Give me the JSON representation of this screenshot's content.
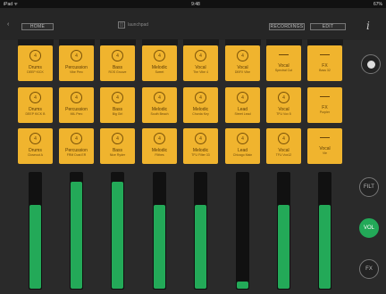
{
  "status": {
    "left": "iPad ᯤ",
    "time": "9:48",
    "battery": "67%"
  },
  "toolbar": {
    "home_label": "HOME",
    "recordings_label": "RECORDINGS",
    "edit_label": "EDIT",
    "logo_text": "launchpad"
  },
  "pads": [
    [
      {
        "name": "Drums",
        "sub": "DEEP KICK",
        "icon": "4"
      },
      {
        "name": "Percussion",
        "sub": "Vibe Perc",
        "icon": "4"
      },
      {
        "name": "Bass",
        "sub": "ROS Groove",
        "icon": "4"
      },
      {
        "name": "Melodic",
        "sub": "Sweet",
        "icon": "4"
      },
      {
        "name": "Vocal",
        "sub": "The Vibe 4",
        "icon": "4"
      },
      {
        "name": "Vocal",
        "sub": "DBFX Vibe",
        "icon": "4"
      },
      {
        "name": "Vocal",
        "sub": "Spectral Cut",
        "icon": "—"
      },
      {
        "name": "FX",
        "sub": "Bass 32",
        "icon": "—"
      }
    ],
    [
      {
        "name": "Drums",
        "sub": "DEEP KICK B",
        "icon": "4"
      },
      {
        "name": "Percussion",
        "sub": "MIL Perc",
        "icon": "4"
      },
      {
        "name": "Bass",
        "sub": "Big Girl",
        "icon": "4"
      },
      {
        "name": "Melodic",
        "sub": "South Beach",
        "icon": "4"
      },
      {
        "name": "Melodic",
        "sub": "Chorda Key",
        "icon": "4"
      },
      {
        "name": "Lead",
        "sub": "Street Lead",
        "icon": "4"
      },
      {
        "name": "Vocal",
        "sub": "TFU Vox 5",
        "icon": "4"
      },
      {
        "name": "FX",
        "sub": "Purpler",
        "icon": "—"
      }
    ],
    [
      {
        "name": "Drums",
        "sub": "Closeout A",
        "icon": "4"
      },
      {
        "name": "Percussion",
        "sub": "FRM Dust ER",
        "icon": "4"
      },
      {
        "name": "Bass",
        "sub": "Nice Ryder",
        "icon": "4"
      },
      {
        "name": "Melodic",
        "sub": "Filthes",
        "icon": "4"
      },
      {
        "name": "Melodic",
        "sub": "TFU Filter 33",
        "icon": "4"
      },
      {
        "name": "Lead",
        "sub": "Chicago Main",
        "icon": "4"
      },
      {
        "name": "Vocal",
        "sub": "TFU Vox12",
        "icon": "4"
      },
      {
        "name": "Vocal",
        "sub": "Vie",
        "icon": "—"
      }
    ]
  ],
  "faders": [
    0.72,
    0.92,
    0.92,
    0.72,
    0.72,
    0.06,
    0.72,
    0.72
  ],
  "side": {
    "filt_label": "FILT",
    "vol_label": "VOL",
    "fx_label": "FX"
  },
  "colors": {
    "pad": "#f0b42e",
    "fader_fill": "#23a958",
    "vol_active": "#23a958"
  }
}
